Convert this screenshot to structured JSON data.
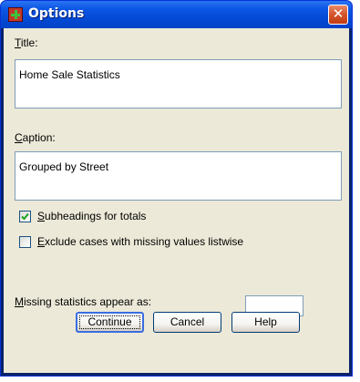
{
  "window": {
    "title": "Options",
    "close_glyph": "✕",
    "icon": "spss-app-icon"
  },
  "fields": {
    "title_label": {
      "underlined": "T",
      "rest": "itle:"
    },
    "title_value": "Home Sale Statistics",
    "caption_label": {
      "underlined": "C",
      "rest": "aption:"
    },
    "caption_value": "Grouped by Street"
  },
  "checkboxes": [
    {
      "underlined": "S",
      "rest": "ubheadings for totals",
      "checked": true
    },
    {
      "underlined": "E",
      "rest": "xclude cases with missing values listwise",
      "checked": false
    }
  ],
  "missing": {
    "label_underlined": "M",
    "label_rest": "issing statistics appear as:",
    "value": ""
  },
  "buttons": {
    "continue": "Continue",
    "cancel": "Cancel",
    "help": "Help"
  },
  "colors": {
    "titlebar": "#0b56e5",
    "dialog_bg": "#ece9d8",
    "field_border": "#7f9db9",
    "close_button": "#d4542a"
  }
}
